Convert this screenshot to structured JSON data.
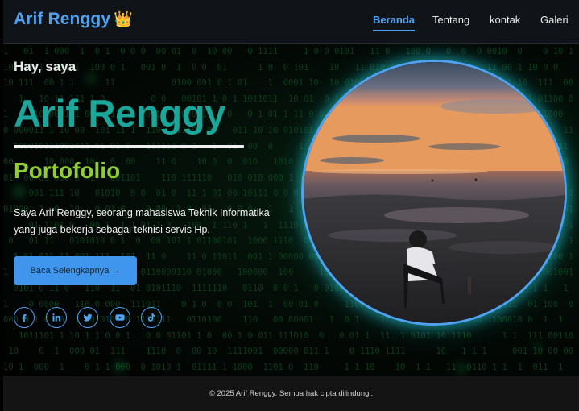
{
  "navbar": {
    "brand": "Arif Renggy",
    "brand_emoji": "👑",
    "links": [
      {
        "label": "Beranda",
        "active": true
      },
      {
        "label": "Tentang",
        "active": false
      },
      {
        "label": "kontak",
        "active": false
      },
      {
        "label": "Galeri",
        "active": false
      }
    ]
  },
  "hero": {
    "greeting": "Hay, saya",
    "name": "Arif Renggy",
    "role": "Portofolio",
    "description": "Saya Arif Renggy, seorang mahasiswa Teknik Informatika yang juga bekerja sebagai teknisi servis Hp.",
    "cta_label": "Baca Selengkapnya →",
    "socials": [
      "facebook-icon",
      "linkedin-icon",
      "twitter-icon",
      "youtube-icon",
      "tiktok-icon"
    ],
    "photo": "profile-photo-beach-sunset"
  },
  "footer": {
    "copyright": "© 2025 Arif Renggy. Semua hak cipta dilindungi."
  },
  "colors": {
    "accent_blue": "#4ea2f0",
    "name_teal": "#1aa69a",
    "role_green": "#8fce2e",
    "background": "#020403",
    "matrix_green": "#0f3d1e"
  }
}
